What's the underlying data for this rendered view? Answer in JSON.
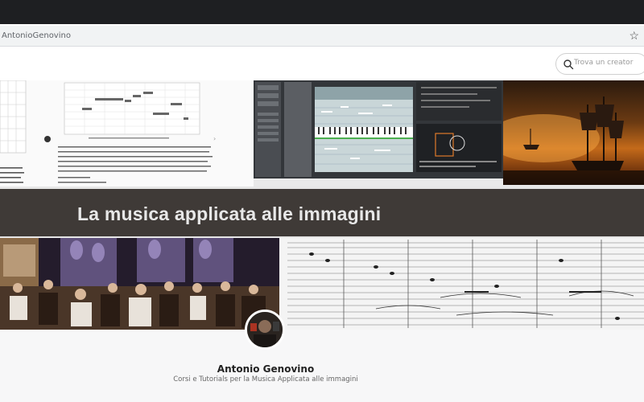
{
  "browser": {
    "url_text": "AntonioGenovino",
    "bookmark_icon": "star-icon"
  },
  "header": {
    "search": {
      "placeholder": "Trova un creator",
      "icon": "search-icon"
    }
  },
  "banner": {
    "title": "La musica applicata alle immagini"
  },
  "profile": {
    "name": "Antonio Genovino",
    "description": "Corsi e Tutorials per la Musica Applicata alle immagini"
  }
}
